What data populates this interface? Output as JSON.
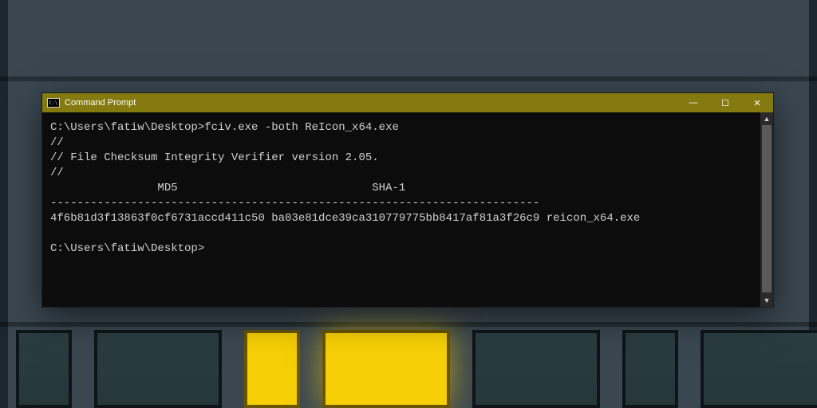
{
  "window": {
    "title": "Command Prompt",
    "minimize_glyph": "—",
    "maximize_glyph": "☐",
    "close_glyph": "✕"
  },
  "terminal": {
    "lines": [
      "C:\\Users\\fatiw\\Desktop>fciv.exe -both ReIcon_x64.exe",
      "//",
      "// File Checksum Integrity Verifier version 2.05.",
      "//",
      "                MD5                             SHA-1",
      "-------------------------------------------------------------------------",
      "4f6b81d3f13863f0cf6731accd411c50 ba03e81dce39ca310779775bb8417af81a3f26c9 reicon_x64.exe",
      "",
      "C:\\Users\\fatiw\\Desktop>"
    ]
  },
  "scrollbar": {
    "up_glyph": "▲",
    "down_glyph": "▼"
  }
}
